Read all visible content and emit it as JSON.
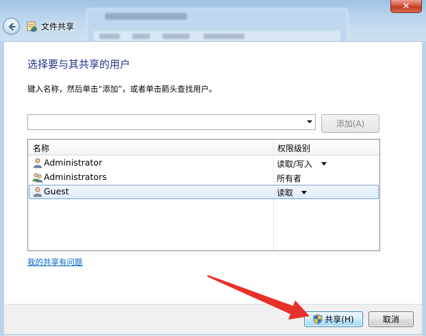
{
  "window": {
    "title": "文件共享",
    "close_label": "✕"
  },
  "dialog": {
    "heading": "选择要与其共享的用户",
    "instruction": "键入名称，然后单击“添加”，或者单击箭头查找用户。",
    "combo": {
      "value": "",
      "placeholder": ""
    },
    "add_button_label": "添加(A)"
  },
  "table": {
    "columns": [
      "名称",
      "权限级别"
    ],
    "rows": [
      {
        "name": "Administrator",
        "permission": "读取/写入",
        "has_dropdown": true,
        "icon": "user-icon",
        "selected": false
      },
      {
        "name": "Administrators",
        "permission": "所有者",
        "has_dropdown": false,
        "icon": "group-icon",
        "selected": false
      },
      {
        "name": "Guest",
        "permission": "读取",
        "has_dropdown": true,
        "icon": "user-icon",
        "selected": true
      }
    ]
  },
  "help_link": "我的共享有问题",
  "footer": {
    "share_label": "共享(H)",
    "cancel_label": "取消"
  },
  "colors": {
    "heading": "#1e3287",
    "link": "#0066cc",
    "annotation_arrow": "#e8312a"
  }
}
